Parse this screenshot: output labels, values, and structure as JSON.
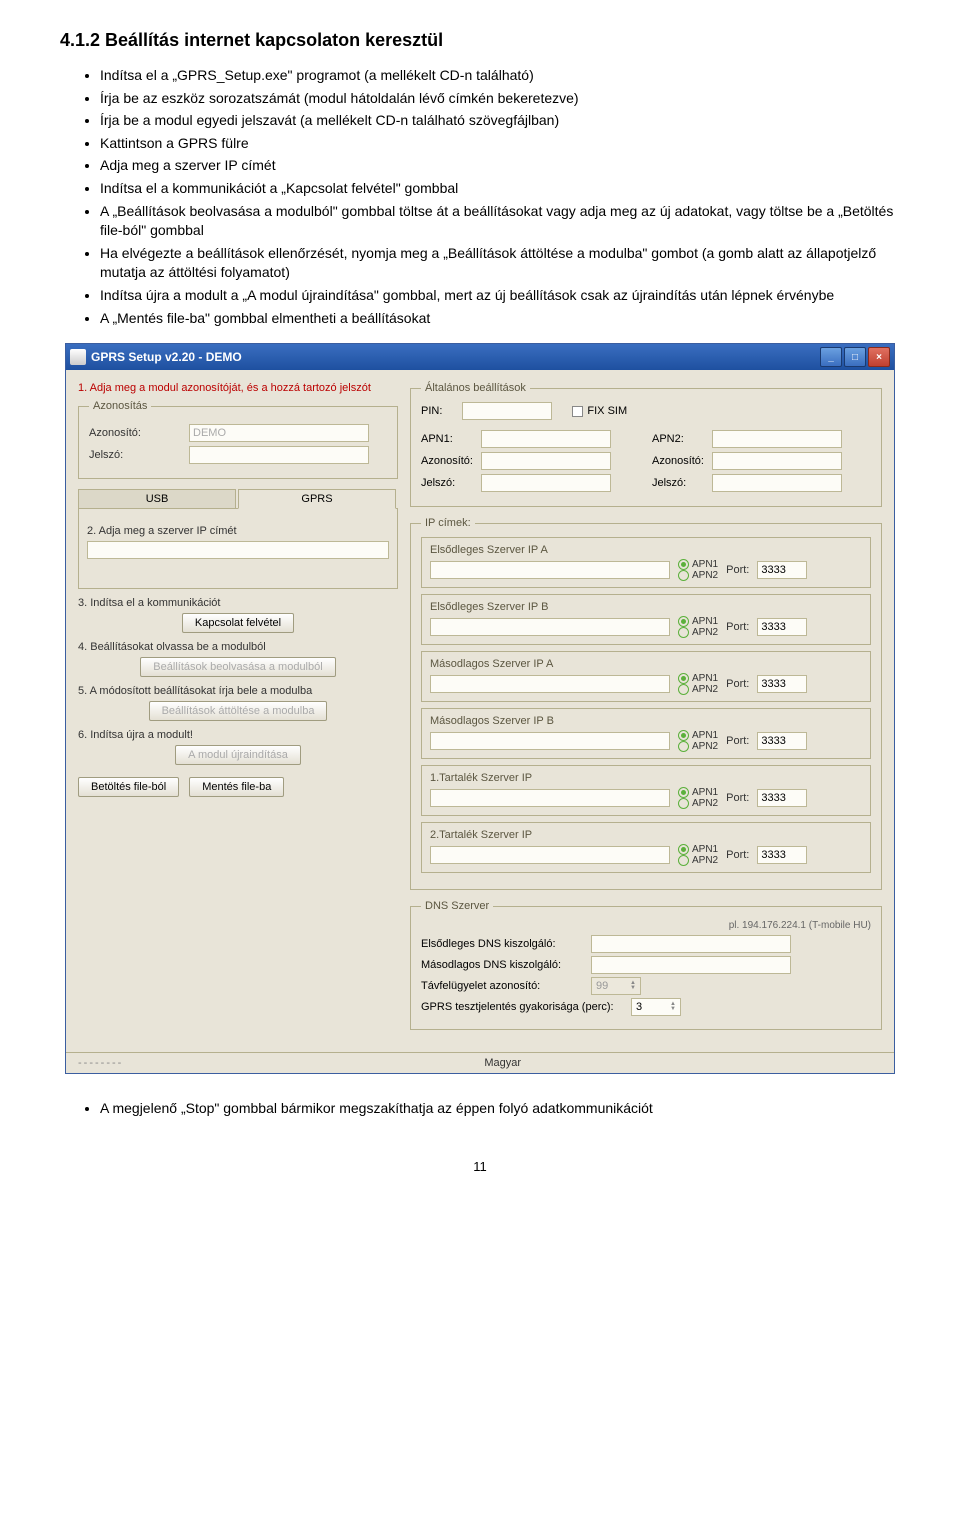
{
  "heading": "4.1.2 Beállítás internet kapcsolaton keresztül",
  "bullets": [
    "Indítsa el a „GPRS_Setup.exe\" programot (a mellékelt CD-n található)",
    "Írja be az eszköz sorozatszámát (modul hátoldalán lévő címkén bekeretezve)",
    "Írja be a modul egyedi jelszavát (a mellékelt CD-n található szövegfájlban)",
    "Kattintson a GPRS fülre",
    "Adja meg a szerver IP címét",
    "Indítsa el a kommunikációt a „Kapcsolat felvétel\" gombbal",
    "A „Beállítások beolvasása a modulból\" gombbal töltse át a beállításokat vagy adja meg az új adatokat, vagy töltse be a „Betöltés file-ból\" gombbal",
    "Ha elvégezte a beállítások ellenőrzését, nyomja meg a „Beállítások áttöltése a modulba\" gombot (a gomb alatt az állapotjelző mutatja az áttöltési folyamatot)",
    "Indítsa újra a modult a „A modul újraindítása\" gombbal, mert az új beállítások csak az újraindítás után lépnek érvénybe",
    "A „Mentés file-ba\" gombbal elmentheti a beállításokat"
  ],
  "window": {
    "title": "GPRS Setup v2.20 - DEMO",
    "left": {
      "step1_text": "1. Adja meg a modul azonosítóját, és a hozzá tartozó jelszót",
      "auth_legend": "Azonosítás",
      "id_label": "Azonosító:",
      "id_value": "DEMO",
      "pw_label": "Jelszó:",
      "pw_value": "",
      "tab_usb": "USB",
      "tab_gprs": "GPRS",
      "step2": "2. Adja meg a szerver IP címét",
      "server_ip": "",
      "step3": "3. Indítsa el a kommunikációt",
      "btn_connect": "Kapcsolat felvétel",
      "step4": "4. Beállításokat olvassa be a modulból",
      "btn_read": "Beállítások beolvasása a modulból",
      "step5": "5. A módosított beállításokat írja bele a modulba",
      "btn_write": "Beállítások áttöltése a modulba",
      "step6": "6. Indítsa újra a modult!",
      "btn_restart": "A modul újraindítása",
      "btn_load": "Betöltés file-ból",
      "btn_save": "Mentés file-ba"
    },
    "right": {
      "general_legend": "Általános beállítások",
      "pin_label": "PIN:",
      "fix_sim": "FIX SIM",
      "apn1": "APN1:",
      "apn2": "APN2:",
      "az": "Azonosító:",
      "jel": "Jelszó:",
      "ip_legend": "IP címek:",
      "ip_blocks": [
        {
          "title": "Elsődleges Szerver IP A",
          "port": "3333"
        },
        {
          "title": "Elsődleges Szerver IP B",
          "port": "3333"
        },
        {
          "title": "Másodlagos Szerver IP A",
          "port": "3333"
        },
        {
          "title": "Másodlagos Szerver IP B",
          "port": "3333"
        },
        {
          "title": "1.Tartalék Szerver IP",
          "port": "3333"
        },
        {
          "title": "2.Tartalék Szerver IP",
          "port": "3333"
        }
      ],
      "apn_opt1": "APN1",
      "apn_opt2": "APN2",
      "port_label": "Port:",
      "dns_legend": "DNS Szerver",
      "dns_hint": "pl. 194.176.224.1 (T-mobile HU)",
      "dns1_label": "Elsődleges DNS kiszolgáló:",
      "dns2_label": "Másodlagos DNS kiszolgáló:",
      "tavf_label": "Távfelügyelet azonosító:",
      "tavf_value": "99",
      "gprs_test_label": "GPRS tesztjelentés gyakorisága (perc):",
      "gprs_test_value": "3"
    },
    "status_lang": "Magyar"
  },
  "footer": "A megjelenő „Stop\" gombbal bármikor megszakíthatja az éppen folyó adatkommunikációt",
  "page_number": "11"
}
